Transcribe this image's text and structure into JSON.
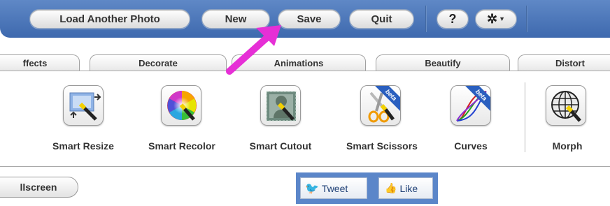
{
  "toolbar": {
    "load_label": "Load Another Photo",
    "new_label": "New",
    "save_label": "Save",
    "quit_label": "Quit",
    "help_label": "?"
  },
  "tabs": [
    {
      "label": "ffects"
    },
    {
      "label": "Decorate"
    },
    {
      "label": "Animations"
    },
    {
      "label": "Beautify"
    },
    {
      "label": "Distort"
    }
  ],
  "tools": [
    {
      "label": "Smart Resize",
      "icon": "smart-resize-icon"
    },
    {
      "label": "Smart Recolor",
      "icon": "color-wheel-icon"
    },
    {
      "label": "Smart Cutout",
      "icon": "cutout-icon"
    },
    {
      "label": "Smart Scissors",
      "icon": "scissors-icon",
      "badge": "beta"
    },
    {
      "label": "Curves",
      "icon": "curves-icon",
      "badge": "beta"
    },
    {
      "label": "Morph",
      "icon": "morph-globe-icon"
    }
  ],
  "bottom": {
    "fullscreen_label": "llscreen",
    "tweet_label": "Tweet",
    "like_label": "Like"
  },
  "colors": {
    "topbar": "#4a76b8",
    "arrow": "#e62fd6",
    "social": "#5b86c9"
  }
}
